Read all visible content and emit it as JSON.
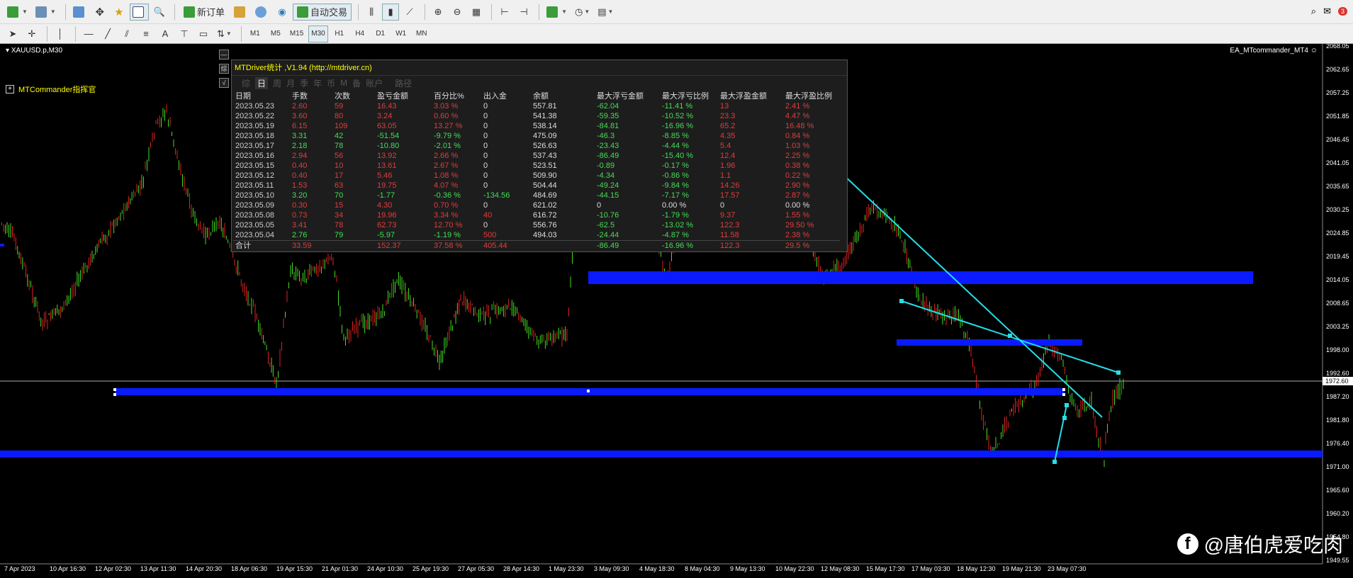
{
  "toolbar_top": {
    "new_order_label": "新订单",
    "auto_trading_label": "自动交易"
  },
  "toolbar_timeframes": [
    "M1",
    "M5",
    "M15",
    "M30",
    "H1",
    "H4",
    "D1",
    "W1",
    "MN"
  ],
  "active_timeframe": "M30",
  "notification_count": "3",
  "chart": {
    "symbol_label": "XAUUSD.p,M30",
    "ea_label": "EA_MTcommander_MT4",
    "commander_label": "MTCommander指挥官",
    "commander_expand": "+",
    "current_price": "1972.60",
    "price_axis": [
      "2068.05",
      "2062.65",
      "2057.25",
      "2051.85",
      "2046.45",
      "2041.05",
      "2035.65",
      "2030.25",
      "2024.85",
      "2019.45",
      "2014.05",
      "2008.65",
      "2003.25",
      "1998.00",
      "1992.60",
      "1987.20",
      "1981.80",
      "1976.40",
      "1971.00",
      "1965.60",
      "1960.20",
      "1954.80",
      "1949.55"
    ],
    "time_axis": [
      "7 Apr 2023",
      "10 Apr 16:30",
      "12 Apr 02:30",
      "13 Apr 11:30",
      "14 Apr 20:30",
      "18 Apr 06:30",
      "19 Apr 15:30",
      "21 Apr 01:30",
      "24 Apr 10:30",
      "25 Apr 19:30",
      "27 Apr 05:30",
      "28 Apr 14:30",
      "1 May 23:30",
      "3 May 09:30",
      "4 May 18:30",
      "8 May 04:30",
      "9 May 13:30",
      "10 May 22:30",
      "12 May 08:30",
      "15 May 17:30",
      "17 May 03:30",
      "18 May 12:30",
      "19 May 21:30",
      "23 May 07:30"
    ],
    "colors": {
      "bull": "#44dd22",
      "bear": "#dd2222",
      "zone": "#0a1aff",
      "trend": "#22e0e8"
    }
  },
  "stats_panel": {
    "title": "MTDriver统计 ,V1.94 (http://mtdriver.cn)",
    "side_buttons": [
      "—",
      "综",
      "√"
    ],
    "tabs": [
      "综",
      "日",
      "周",
      "月",
      "季",
      "年",
      "币",
      "M",
      "备",
      "账户",
      "路径"
    ],
    "selected_tab": "日",
    "headers": [
      "日期",
      "手数",
      "次数",
      "盈亏金额",
      "百分比%",
      "出入金",
      "余额",
      "最大浮亏金额",
      "最大浮亏比例",
      "最大浮盈金额",
      "最大浮盈比例"
    ],
    "rows": [
      [
        "2023.05.23",
        "2.60",
        "59",
        "16.43",
        "3.03 %",
        "0",
        "557.81",
        "-62.04",
        "-11.41 %",
        "13",
        "2.41 %"
      ],
      [
        "2023.05.22",
        "3.60",
        "80",
        "3.24",
        "0.60 %",
        "0",
        "541.38",
        "-59.35",
        "-10.52 %",
        "23.3",
        "4.47 %"
      ],
      [
        "2023.05.19",
        "6.15",
        "109",
        "63.05",
        "13.27 %",
        "0",
        "538.14",
        "-84.81",
        "-16.96 %",
        "65.2",
        "16.48 %"
      ],
      [
        "2023.05.18",
        "3.31",
        "42",
        "-51.54",
        "-9.79 %",
        "0",
        "475.09",
        "-46.3",
        "-8.85 %",
        "4.35",
        "0.84 %"
      ],
      [
        "2023.05.17",
        "2.18",
        "78",
        "-10.80",
        "-2.01 %",
        "0",
        "526.63",
        "-23.43",
        "-4.44 %",
        "5.4",
        "1.03 %"
      ],
      [
        "2023.05.16",
        "2.94",
        "56",
        "13.92",
        "2.66 %",
        "0",
        "537.43",
        "-86.49",
        "-15.40 %",
        "12.4",
        "2.25 %"
      ],
      [
        "2023.05.15",
        "0.40",
        "10",
        "13.61",
        "2.67 %",
        "0",
        "523.51",
        "-0.89",
        "-0.17 %",
        "1.96",
        "0.38 %"
      ],
      [
        "2023.05.12",
        "0.40",
        "17",
        "5.46",
        "1.08 %",
        "0",
        "509.90",
        "-4.34",
        "-0.86 %",
        "1.1",
        "0.22 %"
      ],
      [
        "2023.05.11",
        "1.53",
        "63",
        "19.75",
        "4.07 %",
        "0",
        "504.44",
        "-49.24",
        "-9.84 %",
        "14.26",
        "2.90 %"
      ],
      [
        "2023.05.10",
        "3.20",
        "70",
        "-1.77",
        "-0.36 %",
        "-134.56",
        "484.69",
        "-44.15",
        "-7.17 %",
        "17.57",
        "2.87 %"
      ],
      [
        "2023.05.09",
        "0.30",
        "15",
        "4.30",
        "0.70 %",
        "0",
        "621.02",
        "0",
        "0.00 %",
        "0",
        "0.00 %"
      ],
      [
        "2023.05.08",
        "0.73",
        "34",
        "19.96",
        "3.34 %",
        "40",
        "616.72",
        "-10.76",
        "-1.79 %",
        "9.37",
        "1.55 %"
      ],
      [
        "2023.05.05",
        "3.41",
        "78",
        "62.73",
        "12.70 %",
        "0",
        "556.76",
        "-62.5",
        "-13.02 %",
        "122.3",
        "29.50 %"
      ],
      [
        "2023.05.04",
        "2.76",
        "79",
        "-5.97",
        "-1.19 %",
        "500",
        "494.03",
        "-24.44",
        "-4.87 %",
        "11.58",
        "2.38 %"
      ]
    ],
    "total": [
      "合计",
      "33.59",
      "",
      "152.37",
      "37.58 %",
      "405.44",
      "",
      "-86.49",
      "-16.96 %",
      "122.3",
      "29.5 %"
    ]
  },
  "watermark": {
    "icon": "f",
    "text": "@唐伯虎爱吃肉"
  }
}
